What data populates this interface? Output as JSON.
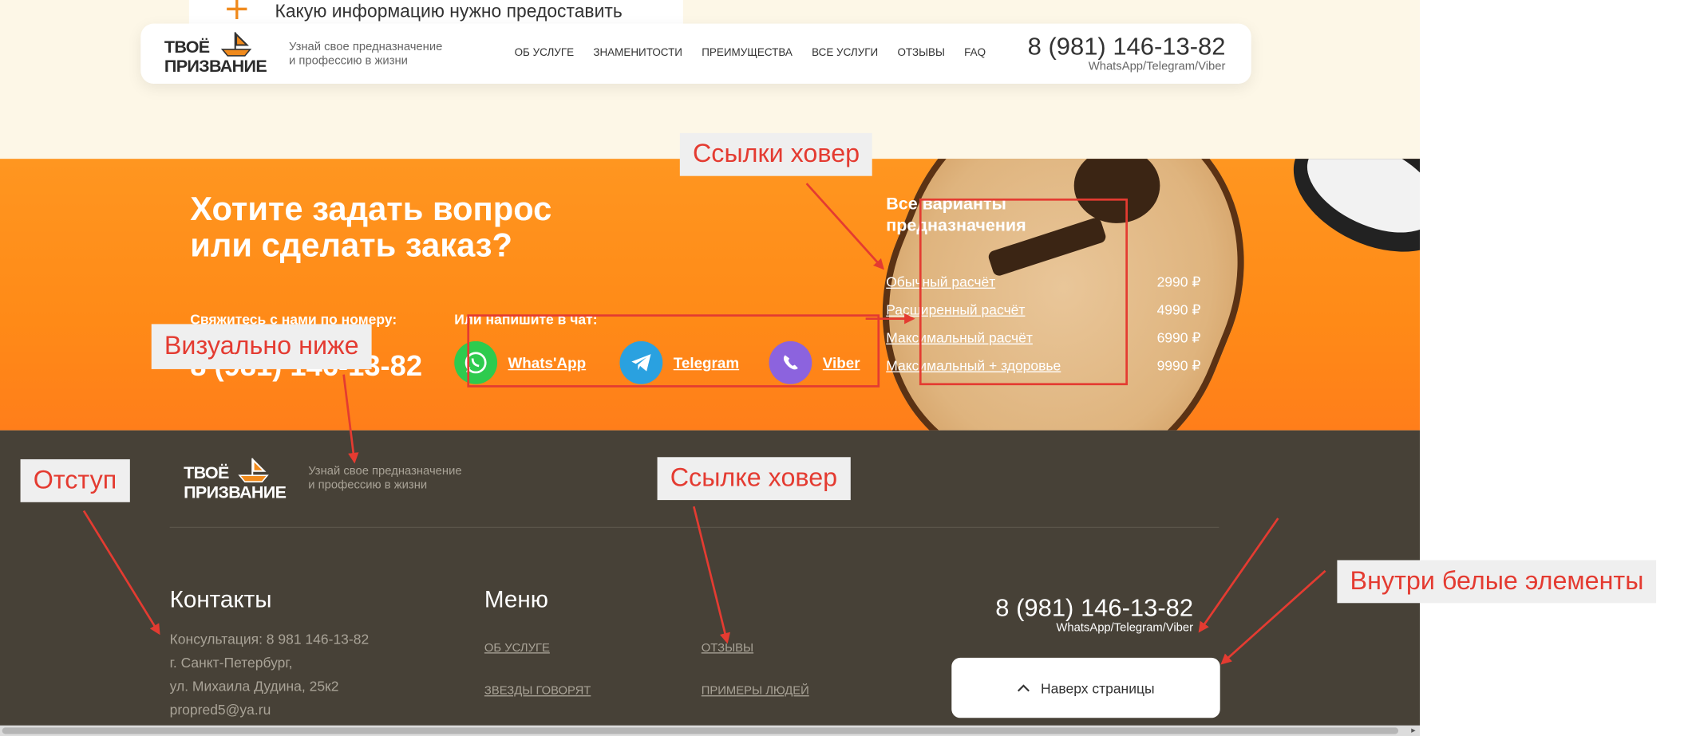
{
  "peek": {
    "text": "Какую информацию нужно предоставить"
  },
  "brand": {
    "line1": "ТВОЁ",
    "line2": "ПРИЗВАНИЕ",
    "tagline_1": "Узнай свое предназначение",
    "tagline_2": "и профессию в жизни"
  },
  "header": {
    "nav": [
      "ОБ УСЛУГЕ",
      "ЗНАМЕНИТОСТИ",
      "ПРЕИМУЩЕСТВА",
      "ВСЕ УСЛУГИ",
      "ОТЗЫВЫ",
      "FAQ"
    ],
    "phone": "8 (981) 146-13-82",
    "messengers": "WhatsApp/Telegram/Viber"
  },
  "cta": {
    "title_1": "Хотите задать вопрос",
    "title_2": "или сделать заказ?",
    "call_label": "Свяжитесь с нами по номеру:",
    "phone": "8 (981) 146-13-82",
    "chat_label": "Или напишите в чат:",
    "chats": [
      "Whats'App",
      "Telegram",
      "Viber"
    ]
  },
  "plans": {
    "title_1": "Все варианты",
    "title_2": "предназначения",
    "items": [
      {
        "name": "Обычный расчёт",
        "price": "2990 ₽"
      },
      {
        "name": "Расширенный расчёт",
        "price": "4990 ₽"
      },
      {
        "name": "Максимальный расчёт",
        "price": "6990 ₽"
      },
      {
        "name": "Максимальный + здоровье",
        "price": "9990 ₽"
      }
    ]
  },
  "footer": {
    "contacts_title": "Контакты",
    "contacts": [
      "Консультация: 8 981 146-13-82",
      "г. Санкт-Петербург,",
      "ул. Михаила Дудина, 25к2",
      "propred5@ya.ru"
    ],
    "menu_title": "Меню",
    "menu": [
      "ОБ УСЛУГЕ",
      "ОТЗЫВЫ",
      "ЗВЕЗДЫ ГОВОРЯТ",
      "ПРИМЕРЫ ЛЮДЕЙ"
    ],
    "phone": "8 (981) 146-13-82",
    "messengers": "WhatsApp/Telegram/Viber",
    "to_top": "Наверх страницы"
  },
  "annotations": {
    "links_hover": "Ссылки ховер",
    "visually_lower": "Визуально ниже",
    "indent": "Отступ",
    "link_hover": "Ссылке ховер",
    "inside_white": "Внутри белые элементы"
  },
  "colors": {
    "accent": "#ff8a17",
    "footer_bg": "#474137",
    "cream": "#fdf7e7",
    "annotation": "#e43b31"
  }
}
